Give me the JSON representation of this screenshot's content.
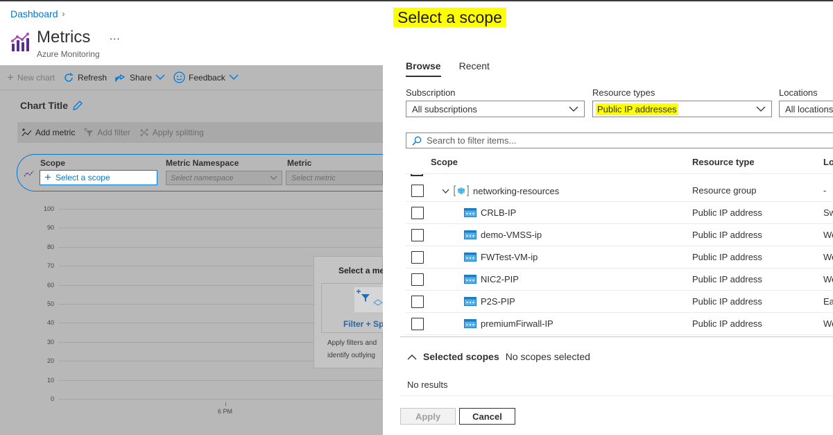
{
  "breadcrumb": {
    "item": "Dashboard"
  },
  "page": {
    "title": "Metrics",
    "more": "...",
    "subtitle": "Azure Monitoring"
  },
  "toolbar": {
    "new_chart": "New chart",
    "refresh": "Refresh",
    "share": "Share",
    "feedback": "Feedback"
  },
  "chart": {
    "title": "Chart Title",
    "add_metric": "Add metric",
    "add_filter": "Add filter",
    "apply_splitting": "Apply splitting",
    "scope_label": "Scope",
    "scope_button": "Select a scope",
    "namespace_label": "Metric Namespace",
    "namespace_placeholder": "Select namespace",
    "metric_label": "Metric",
    "metric_placeholder": "Select metric",
    "y_ticks": [
      "100",
      "90",
      "80",
      "70",
      "60",
      "50",
      "40",
      "30",
      "20",
      "10",
      "0"
    ],
    "x_tick": "6 PM",
    "hint_title": "Select a met",
    "hint_link": "Filter + Sp",
    "hint_line1": "Apply filters and",
    "hint_line2": "identify outlying"
  },
  "panel": {
    "title": "Select a scope",
    "tabs": [
      "Browse",
      "Recent"
    ],
    "active_tab": "Browse",
    "filters": {
      "subscription_label": "Subscription",
      "subscription_value": "All subscriptions",
      "resource_types_label": "Resource types",
      "resource_types_value": "Public IP addresses",
      "locations_label": "Locations",
      "locations_value": "All locations"
    },
    "search_placeholder": "Search to filter items...",
    "columns": {
      "scope": "Scope",
      "resource_type": "Resource type",
      "location": "Lo"
    },
    "rows": [
      {
        "name": "networking-resources",
        "type": "Resource group",
        "location": "-",
        "kind": "group"
      },
      {
        "name": "CRLB-IP",
        "type": "Public IP address",
        "location": "Sw",
        "kind": "ip"
      },
      {
        "name": "demo-VMSS-ip",
        "type": "Public IP address",
        "location": "We",
        "kind": "ip"
      },
      {
        "name": "FWTest-VM-ip",
        "type": "Public IP address",
        "location": "We",
        "kind": "ip"
      },
      {
        "name": "NIC2-PIP",
        "type": "Public IP address",
        "location": "We",
        "kind": "ip"
      },
      {
        "name": "P2S-PIP",
        "type": "Public IP address",
        "location": "Ea",
        "kind": "ip"
      },
      {
        "name": "premiumFirwall-IP",
        "type": "Public IP address",
        "location": "We",
        "kind": "ip"
      }
    ],
    "selected_title": "Selected scopes",
    "selected_value": "No scopes selected",
    "no_results": "No results",
    "apply": "Apply",
    "cancel": "Cancel"
  },
  "colors": {
    "accent": "#0078d4",
    "highlight": "#ffff00",
    "overlay": "#b8b8b8"
  },
  "icons": [
    "chevron-right-icon",
    "metrics-icon",
    "plus-icon",
    "refresh-icon",
    "share-icon",
    "feedback-icon",
    "pencil-icon",
    "add-metric-icon",
    "filter-icon",
    "splitting-icon",
    "chevron-down-icon",
    "search-icon",
    "resource-group-icon",
    "public-ip-icon",
    "chevron-up-icon"
  ]
}
